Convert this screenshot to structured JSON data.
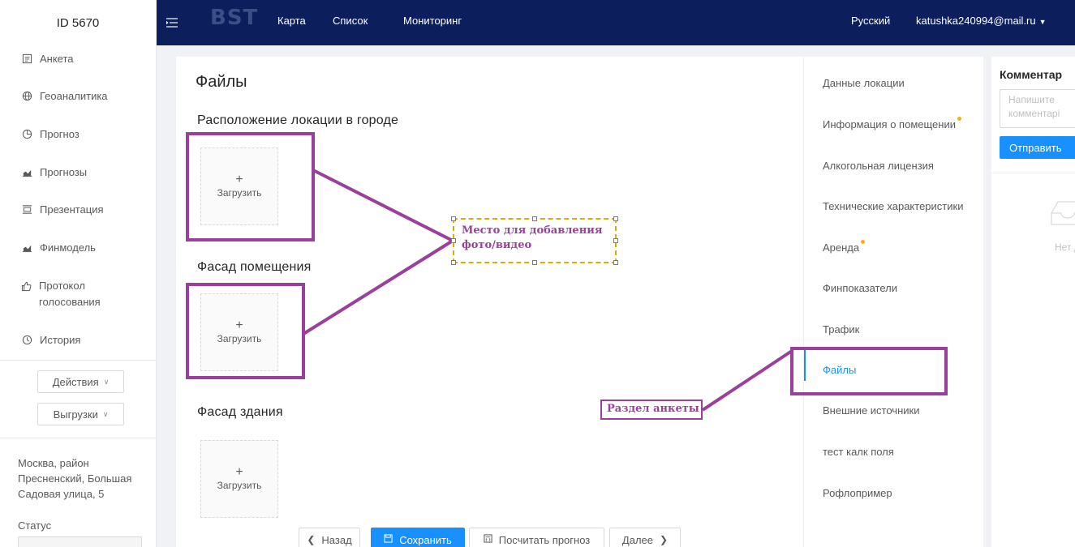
{
  "sidebar": {
    "id_label": "ID 5670",
    "items": [
      {
        "label": "Анкета",
        "icon": "form-icon"
      },
      {
        "label": "Геоаналитика",
        "icon": "globe-icon"
      },
      {
        "label": "Прогноз",
        "icon": "pie-chart-icon"
      },
      {
        "label": "Прогнозы",
        "icon": "area-chart-icon"
      },
      {
        "label": "Презентация",
        "icon": "presentation-icon"
      },
      {
        "label": "Финмодель",
        "icon": "area-chart-icon"
      },
      {
        "label": "Протокол голосования",
        "icon": "like-icon"
      },
      {
        "label": "История",
        "icon": "clock-icon"
      }
    ],
    "actions_label": "Действия",
    "exports_label": "Выгрузки",
    "address": "Москва, район Пресненский, Большая Садовая улица, 5",
    "status_label": "Статус"
  },
  "topbar": {
    "logo": "BST",
    "nav": [
      "Карта",
      "Список",
      "Мониторинг"
    ],
    "language": "Русский",
    "user_email": "katushka240994@mail.ru"
  },
  "main": {
    "title": "Файлы",
    "sections": [
      {
        "title": "Расположение локации в городе",
        "upload_label": "Загрузить"
      },
      {
        "title": "Фасад помещения",
        "upload_label": "Загрузить"
      },
      {
        "title": "Фасад здания",
        "upload_label": "Загрузить"
      }
    ],
    "buttons": {
      "back": "Назад",
      "save": "Сохранить",
      "calc": "Посчитать прогноз",
      "next": "Далее"
    }
  },
  "section_nav": {
    "items": [
      {
        "label": "Данные локации",
        "dot": false,
        "active": false
      },
      {
        "label": "Информация о помещении",
        "dot": true,
        "active": false
      },
      {
        "label": "Алкогольная лицензия",
        "dot": false,
        "active": false
      },
      {
        "label": "Технические характеристики",
        "dot": false,
        "active": false
      },
      {
        "label": "Аренда",
        "dot": true,
        "active": false
      },
      {
        "label": "Финпоказатели",
        "dot": false,
        "active": false
      },
      {
        "label": "Трафик",
        "dot": false,
        "active": false
      },
      {
        "label": "Файлы",
        "dot": false,
        "active": true
      },
      {
        "label": "Внешние источники",
        "dot": false,
        "active": false
      },
      {
        "label": "тест калк поля",
        "dot": false,
        "active": false
      },
      {
        "label": "Рофлопример",
        "dot": false,
        "active": false
      }
    ]
  },
  "comments": {
    "title": "Комментар",
    "placeholder_line1": "Напишите",
    "placeholder_line2": "комментарі",
    "send_label": "Отправить",
    "empty_text": "Нет д"
  },
  "annotations": {
    "media_place": "Место для добавления фото/видео",
    "form_section": "Раздел анкеты",
    "accent_color": "#9b3f9e"
  },
  "colors": {
    "topbar": "#0c1e5b",
    "primary": "#1890ff",
    "dot": "#faad14"
  }
}
